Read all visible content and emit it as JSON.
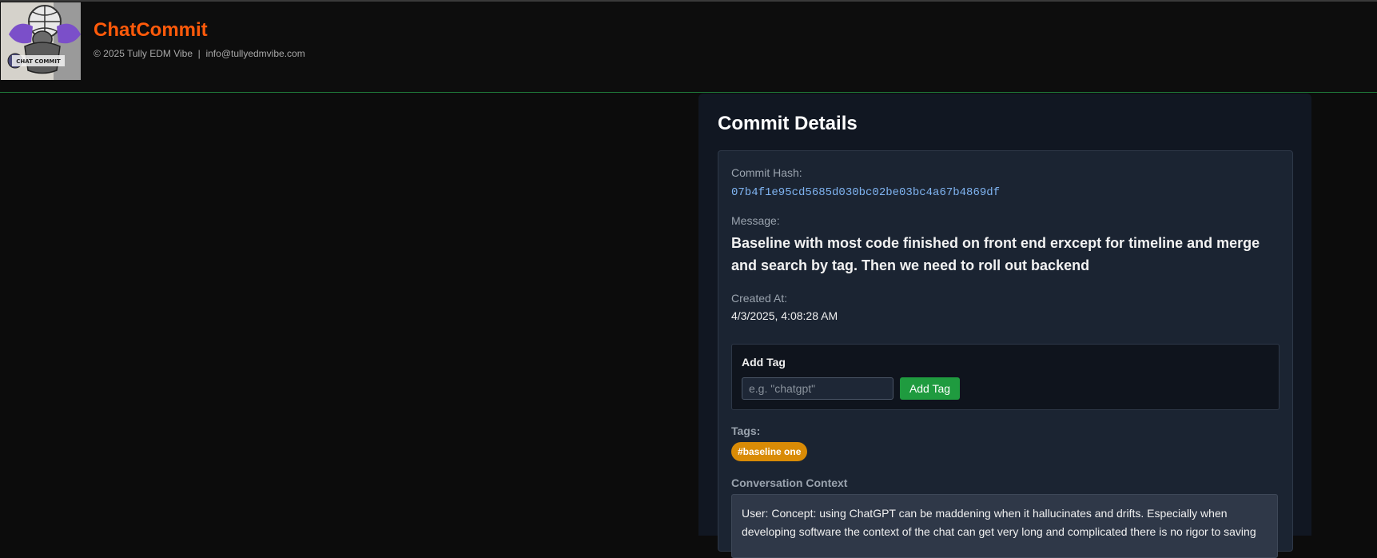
{
  "header": {
    "app_title": "ChatCommit",
    "footer_line": "© 2025 Tully EDM Vibe  |  info@tullyedmvibe.com",
    "logo_text": "CHAT COMMIT"
  },
  "commit": {
    "panel_title": "Commit Details",
    "hash_label": "Commit Hash:",
    "hash": "07b4f1e95cd5685d030bc02be03bc4a67b4869df",
    "message_label": "Message:",
    "message": "Baseline with most code finished on front end erxcept for timeline and merge and search by tag. Then we need to roll out backend",
    "created_label": "Created At:",
    "created_at": "4/3/2025, 4:08:28 AM"
  },
  "add_tag": {
    "title": "Add Tag",
    "placeholder": "e.g. \"chatgpt\"",
    "value": "",
    "button_label": "Add Tag"
  },
  "tags": {
    "label": "Tags:",
    "items": [
      "#baseline one"
    ]
  },
  "context": {
    "label": "Conversation Context",
    "text": "User: Concept: using ChatGPT can be maddening when it hallucinates and drifts. Especially when developing software the context of the chat can get very long and complicated there is no rigor to saving"
  },
  "colors": {
    "brand": "#ff5a0a",
    "accent_green": "#1f9b3f",
    "tag_orange": "#d98b06",
    "hash_blue": "#7fb3f0"
  }
}
